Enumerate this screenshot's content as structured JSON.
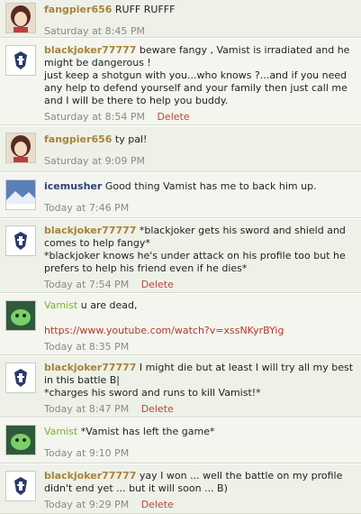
{
  "posts": [
    {
      "avatar": "anime-girl-avatar",
      "user": "fangpier656",
      "lines": [
        "RUFF RUFFF"
      ],
      "time": "Saturday at 8:45 PM"
    },
    {
      "avatar": "crest-avatar",
      "user": "blackjoker77777",
      "lines": [
        "beware fangy , Vamist is irradiated and he might be dangerous !",
        "just keep a shotgun with you...who knows ?...and if you need any help to defend yourself and your family then just call me and I will be there to help you buddy."
      ],
      "time": "Saturday at 8:54 PM",
      "delete": "Delete"
    },
    {
      "avatar": "anime-girl-avatar",
      "user": "fangpier656",
      "lines": [
        "ty pal!"
      ],
      "time": "Saturday at 9:09 PM"
    },
    {
      "avatar": "snow-landscape-avatar",
      "user": "icemusher",
      "lines": [
        "Good thing Vamist has me to back him up."
      ],
      "time": "Today at 7:46 PM"
    },
    {
      "avatar": "crest-avatar",
      "user": "blackjoker77777",
      "lines": [
        "*blackjoker gets his sword and shield and comes to help fangy*",
        "*blackjoker knows he's under attack on his profile too but he prefers to help his friend even if he dies*"
      ],
      "time": "Today at 7:54 PM",
      "delete": "Delete"
    },
    {
      "avatar": "green-creature-avatar",
      "user": "Vamist",
      "lines": [
        "u are dead,"
      ],
      "link": "https://www.youtube.com/watch?v=xssNKyrBYig",
      "time": "Today at 8:35 PM"
    },
    {
      "avatar": "crest-avatar",
      "user": "blackjoker77777",
      "lines": [
        "I might die but at least I will try all my best in this battle B|",
        "*charges his sword and runs to kill Vamist!*"
      ],
      "time": "Today at 8:47 PM",
      "delete": "Delete"
    },
    {
      "avatar": "green-creature-avatar",
      "user": "Vamist",
      "lines": [
        "*Vamist has left the game*"
      ],
      "time": "Today at 9:10 PM"
    },
    {
      "avatar": "crest-avatar",
      "user": "blackjoker77777",
      "lines": [
        "yay I won ... well the battle on my profile didn't end yet ... but it will soon ... B)"
      ],
      "time": "Today at 9:29 PM",
      "delete": "Delete"
    }
  ],
  "colors": {
    "gold_user": "#a8833a",
    "navy_user": "#2d3f7a",
    "green_user": "#7cb32a",
    "link": "#b03a2e",
    "delete": "#b04a3a",
    "meta": "#8a8a8a",
    "post_bg": "#eef1e8"
  }
}
